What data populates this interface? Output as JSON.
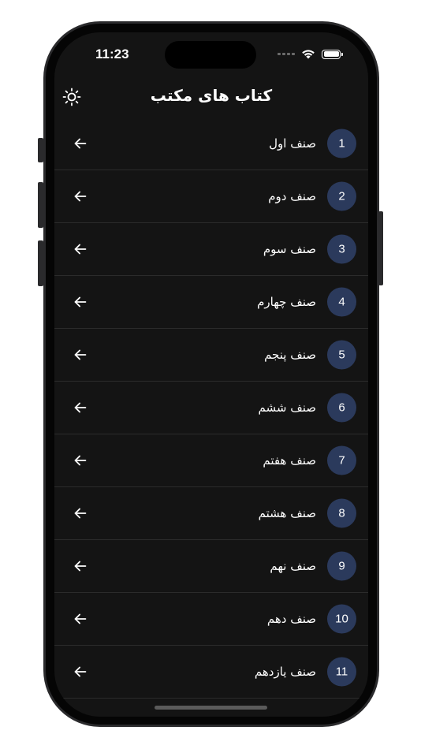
{
  "status_bar": {
    "time": "11:23"
  },
  "header": {
    "title": "کتاب های مکتب",
    "theme_icon": "sun-icon"
  },
  "colors": {
    "background": "#141414",
    "badge": "#2b3a5c",
    "text": "#ffffff",
    "divider": "#2b2b2b"
  },
  "grades": [
    {
      "number": "1",
      "label": "صنف اول"
    },
    {
      "number": "2",
      "label": "صنف دوم"
    },
    {
      "number": "3",
      "label": "صنف سوم"
    },
    {
      "number": "4",
      "label": "صنف چهارم"
    },
    {
      "number": "5",
      "label": "صنف پنجم"
    },
    {
      "number": "6",
      "label": "صنف ششم"
    },
    {
      "number": "7",
      "label": "صنف هفتم"
    },
    {
      "number": "8",
      "label": "صنف هشتم"
    },
    {
      "number": "9",
      "label": "صنف نهم"
    },
    {
      "number": "10",
      "label": "صنف دهم"
    },
    {
      "number": "11",
      "label": "صنف یازدهم"
    }
  ]
}
